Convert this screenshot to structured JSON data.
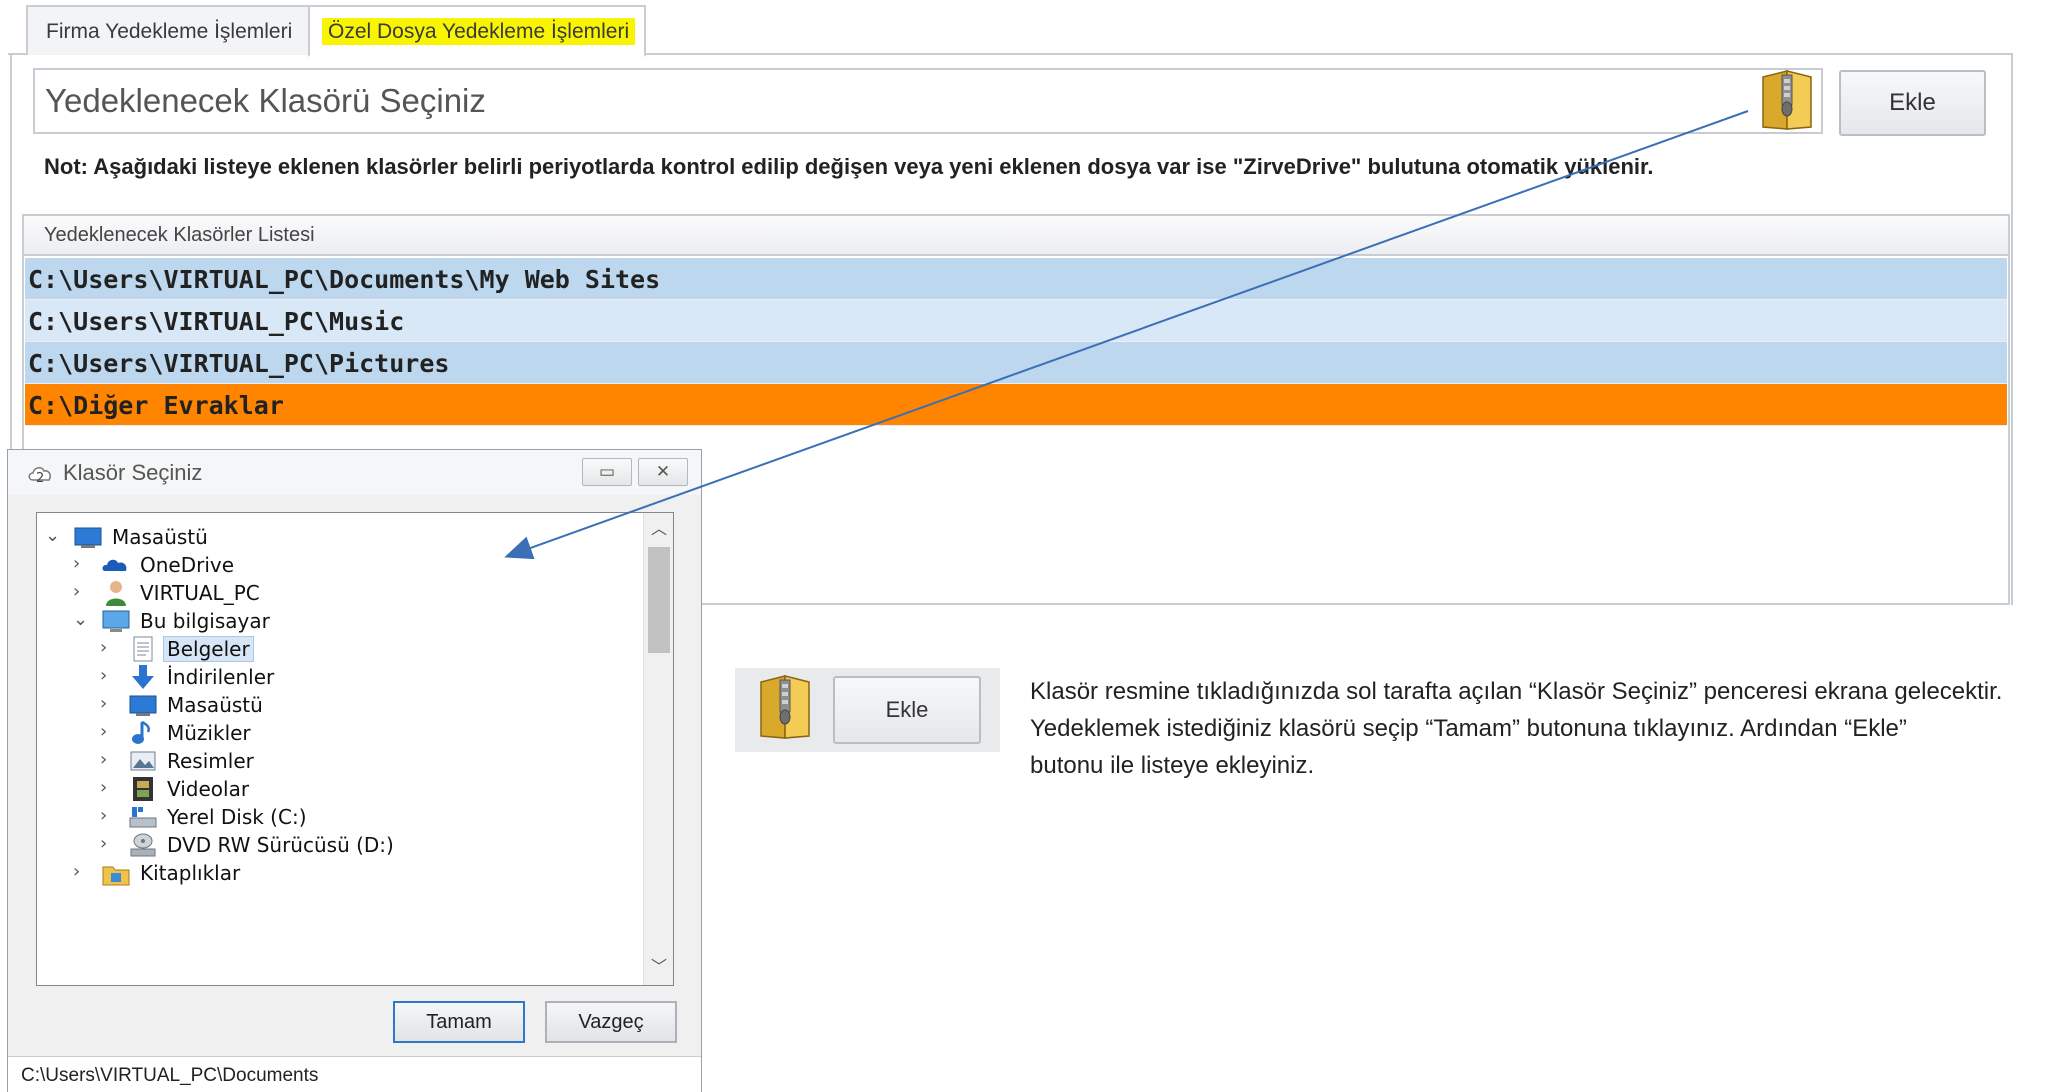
{
  "tabs": [
    {
      "label": "Firma Yedekleme İşlemleri"
    },
    {
      "label": "Özel Dosya Yedekleme İşlemleri"
    }
  ],
  "folder_input": {
    "value": "Yedeklenecek Klasörü Seçiniz"
  },
  "ekle_button": {
    "label": "Ekle"
  },
  "note": "Not: Aşağıdaki listeye eklenen klasörler belirli periyotlarda kontrol edilip değişen veya yeni eklenen dosya var ise \"ZirveDrive\" bulutuna otomatik yüklenir.",
  "list": {
    "header": "Yedeklenecek Klasörler Listesi",
    "rows": [
      "C:\\Users\\VIRTUAL_PC\\Documents\\My Web Sites",
      "C:\\Users\\VIRTUAL_PC\\Music",
      "C:\\Users\\VIRTUAL_PC\\Pictures",
      "C:\\Diğer Evraklar"
    ]
  },
  "dialog": {
    "title": "Klasör Seçiniz",
    "tree": [
      {
        "label": "Masaüstü",
        "icon": "desktop-icon"
      },
      {
        "label": "OneDrive",
        "icon": "onedrive-icon"
      },
      {
        "label": "VIRTUAL_PC",
        "icon": "user-icon"
      },
      {
        "label": "Bu bilgisayar",
        "icon": "computer-icon"
      },
      {
        "label": "Belgeler",
        "icon": "documents-icon"
      },
      {
        "label": "İndirilenler",
        "icon": "downloads-icon"
      },
      {
        "label": "Masaüstü",
        "icon": "desktop-icon"
      },
      {
        "label": "Müzikler",
        "icon": "music-icon"
      },
      {
        "label": "Resimler",
        "icon": "pictures-icon"
      },
      {
        "label": "Videolar",
        "icon": "videos-icon"
      },
      {
        "label": "Yerel Disk (C:)",
        "icon": "local-disk-icon"
      },
      {
        "label": "DVD RW Sürücüsü (D:)",
        "icon": "dvd-drive-icon"
      },
      {
        "label": "Kitaplıklar",
        "icon": "libraries-icon"
      }
    ],
    "ok_label": "Tamam",
    "cancel_label": "Vazgeç",
    "status_path": "C:\\Users\\VIRTUAL_PC\\Documents"
  },
  "demo": {
    "ekle_label": "Ekle"
  },
  "description": [
    "Klasör resmine tıkladığınızda sol tarafta açılan “Klasör Seçiniz” penceresi ekrana gelecektir.",
    "Yedeklemek istediğiniz klasörü seçip “Tamam” butonuna tıklayınız. Ardından “Ekle”",
    "butonu ile listeye ekleyiniz."
  ],
  "colors": {
    "selected_row": "#ff8400",
    "row_blue": "#bcd7ee",
    "row_light_blue": "#d9e8f6",
    "tab_highlight": "#f9f500",
    "arrow": "#3b6fb6"
  }
}
